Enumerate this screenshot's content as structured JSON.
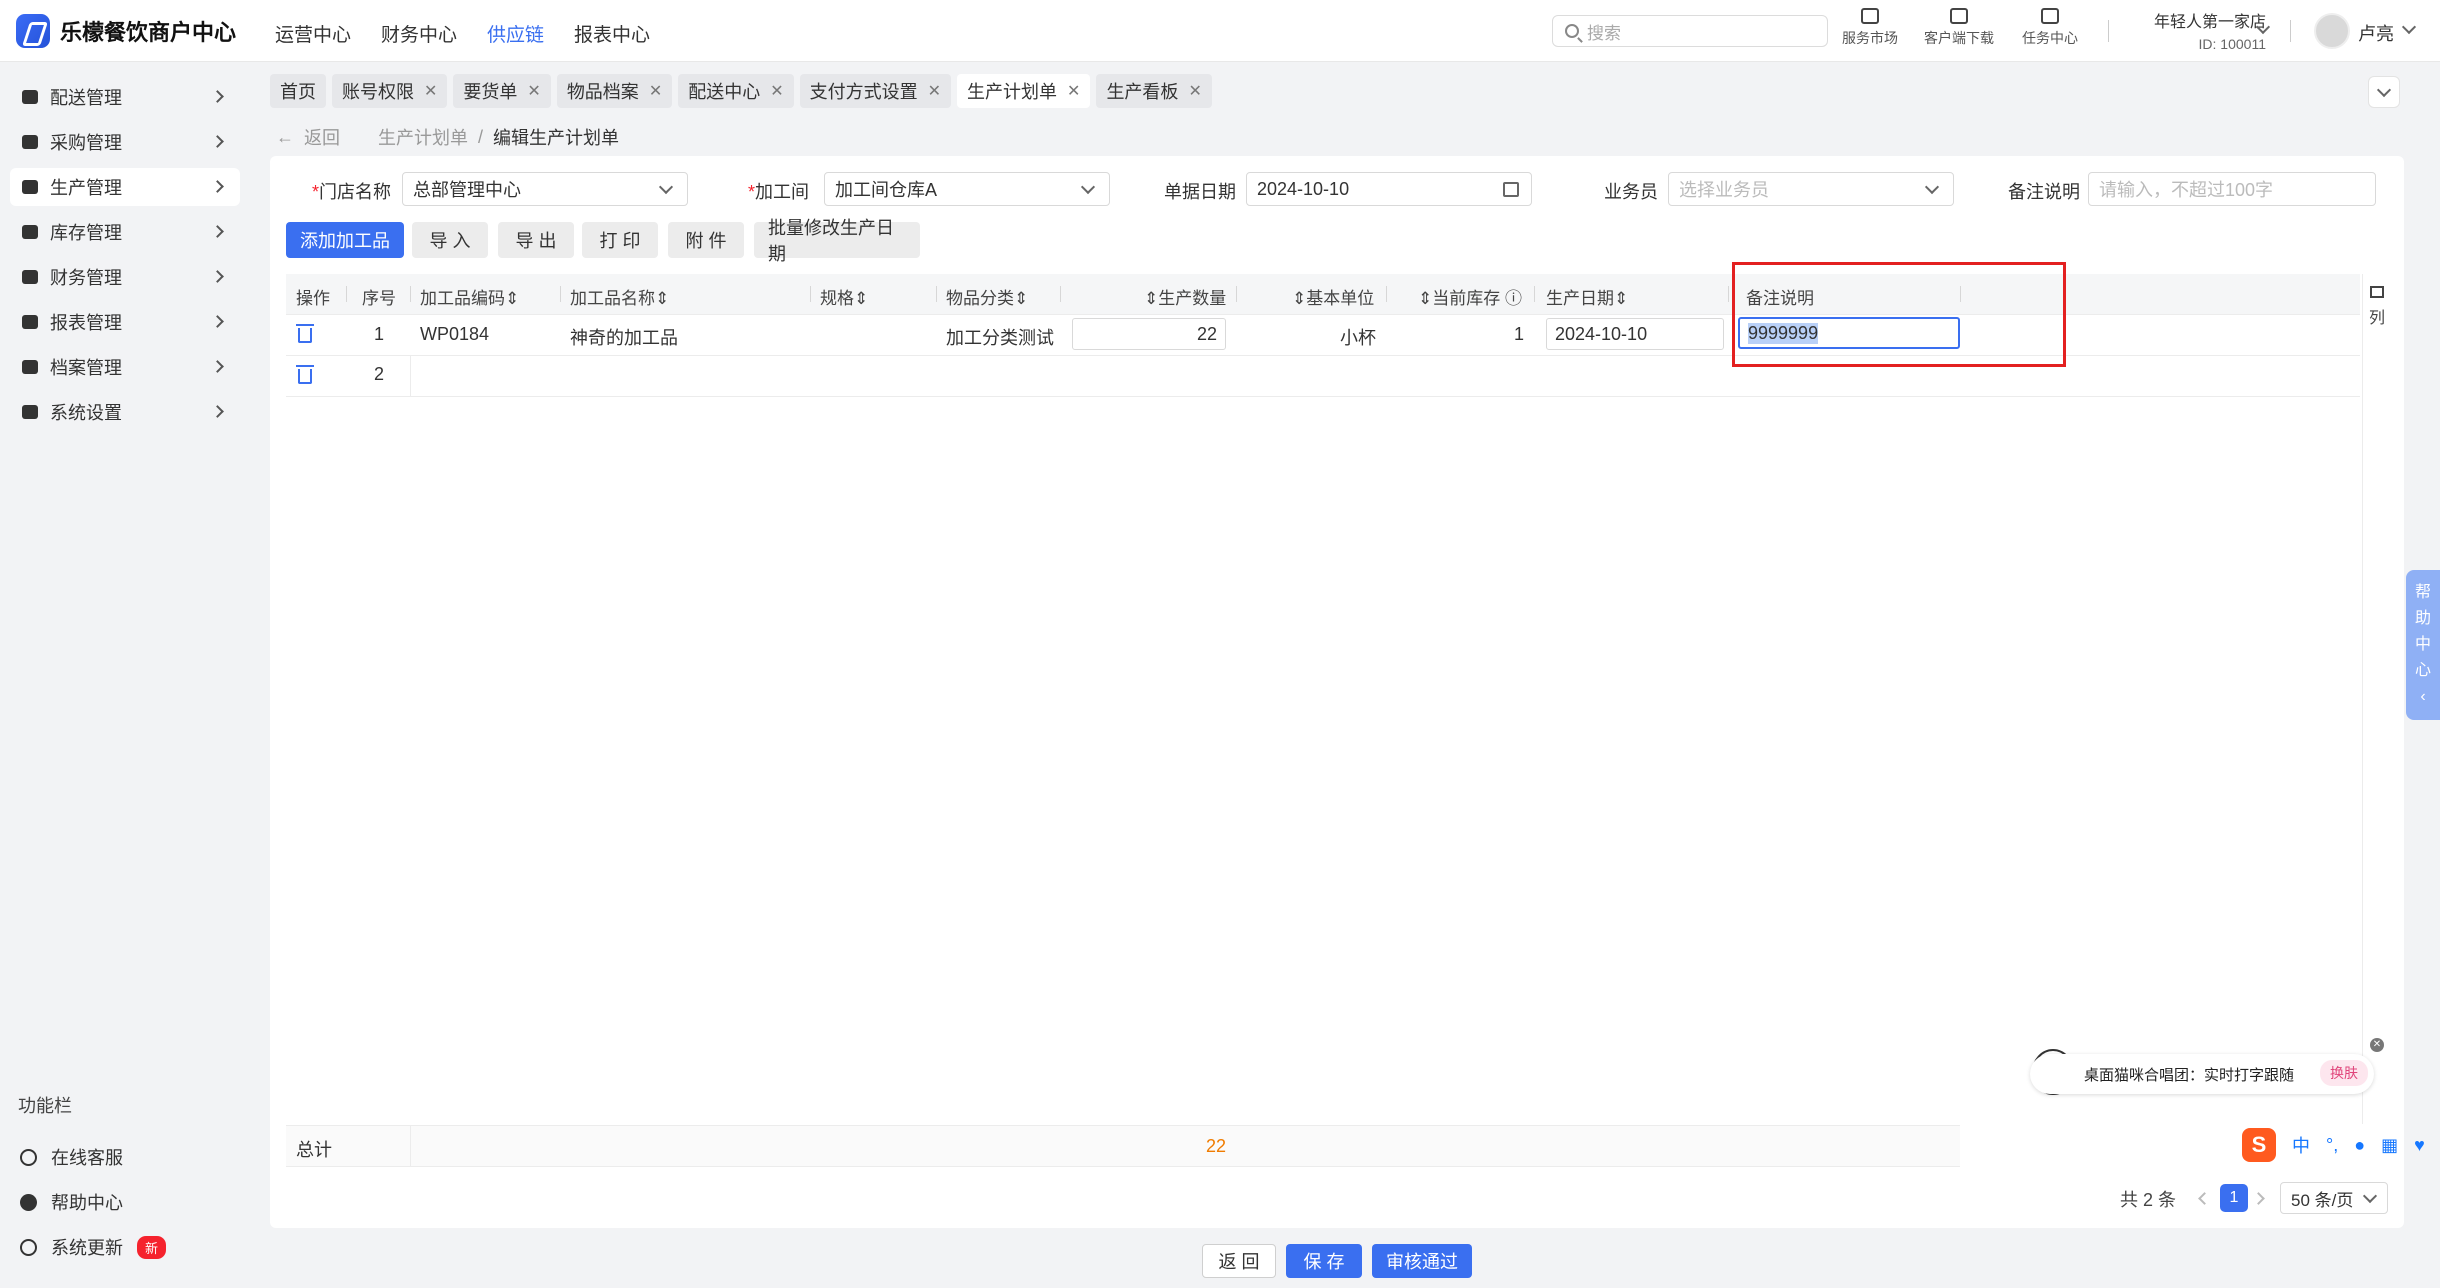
{
  "app": {
    "title": "乐檬餐饮商户中心"
  },
  "topnav": [
    "运营中心",
    "财务中心",
    "供应链",
    "报表中心"
  ],
  "search": {
    "placeholder": "搜索"
  },
  "tools": [
    "服务市场",
    "客户端下载",
    "任务中心"
  ],
  "store": {
    "name": "年轻人第一家店",
    "id": "ID: 100011"
  },
  "user": {
    "name": "卢亮"
  },
  "sidebar": {
    "items": [
      "配送管理",
      "采购管理",
      "生产管理",
      "库存管理",
      "财务管理",
      "报表管理",
      "档案管理",
      "系统设置"
    ],
    "func_title": "功能栏",
    "func_items": [
      "在线客服",
      "帮助中心",
      "系统更新"
    ],
    "new_badge": "新"
  },
  "tabs": [
    "首页",
    "账号权限",
    "要货单",
    "物品档案",
    "配送中心",
    "支付方式设置",
    "生产计划单",
    "生产看板"
  ],
  "breadcrumb": {
    "back": "返回",
    "parent": "生产计划单",
    "current": "编辑生产计划单"
  },
  "form": {
    "store_label": "门店名称",
    "store_value": "总部管理中心",
    "workshop_label": "加工间",
    "workshop_value": "加工间仓库A",
    "date_label": "单据日期",
    "date_value": "2024-10-10",
    "salesman_label": "业务员",
    "salesman_placeholder": "选择业务员",
    "remark_label": "备注说明",
    "remark_placeholder": "请输入，不超过100字"
  },
  "actions": [
    "添加加工品",
    "导 入",
    "导 出",
    "打 印",
    "附 件",
    "批量修改生产日期"
  ],
  "table": {
    "headers": [
      "操作",
      "序号",
      "加工品编码",
      "加工品名称",
      "规格",
      "物品分类",
      "生产数量",
      "基本单位",
      "当前库存",
      "生产日期",
      "备注说明"
    ],
    "column_setting": "列",
    "rows": [
      {
        "seq": "1",
        "code": "WP0184",
        "name": "神奇的加工品",
        "spec": "",
        "category": "加工分类测试",
        "qty": "22",
        "unit": "小杯",
        "stock": "1",
        "date": "2024-10-10",
        "remark": "9999999"
      },
      {
        "seq": "2",
        "code": "",
        "name": "",
        "spec": "",
        "category": "",
        "qty": "",
        "unit": "",
        "stock": "",
        "date": "",
        "remark": ""
      }
    ],
    "total_label": "总计",
    "total_qty": "22"
  },
  "pagination": {
    "total": "共 2 条",
    "page": "1",
    "size": "50 条/页"
  },
  "footer": {
    "back": "返 回",
    "save": "保 存",
    "approve": "审核通过"
  },
  "help_float": "帮助中心",
  "ime": {
    "text": "桌面猫咪合唱团：实时打字跟随",
    "skin": "换肤",
    "logo": "S",
    "mode": "中"
  },
  "colors": {
    "primary": "#3a6ff0",
    "highlight": "#e32020",
    "total": "#f07c00"
  }
}
